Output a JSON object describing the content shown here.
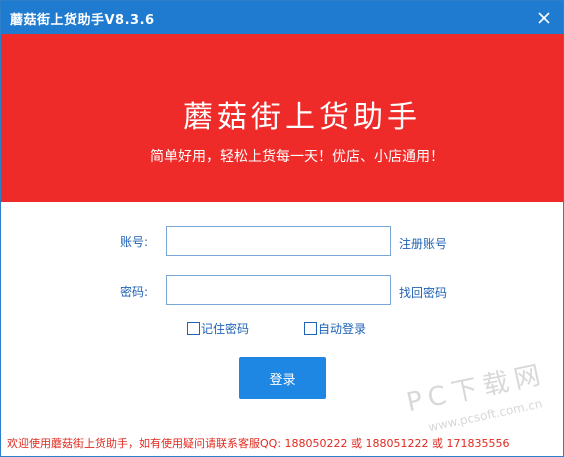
{
  "window": {
    "title": "蘑菇街上货助手V8.3.6"
  },
  "banner": {
    "title": "蘑菇街上货助手",
    "subtitle": "简单好用，轻松上货每一天！优店、小店通用！",
    "color": "#ef2b2a"
  },
  "form": {
    "account_label": "账号:",
    "account_value": "",
    "register_link": "注册账号",
    "password_label": "密码:",
    "password_value": "",
    "recover_link": "找回密码",
    "remember_password": "记住密码",
    "remember_checked": false,
    "auto_login": "自动登录",
    "auto_login_checked": false,
    "login_button": "登录"
  },
  "footer": {
    "text": "欢迎使用蘑菇街上货助手，如有使用疑问请联系客服QQ: 188050222 或 188051222 或 171835556"
  },
  "watermark": {
    "line1": "PC下载网",
    "line2": "www.pcsoft.com.cn"
  },
  "colors": {
    "titlebar": "#1e7bd0",
    "accent": "#1e86e3",
    "link": "#1f62b5",
    "footer_text": "#e12a20"
  }
}
